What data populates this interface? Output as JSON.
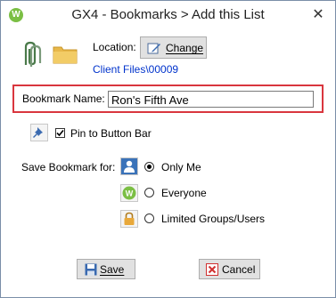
{
  "window": {
    "title": "GX4 - Bookmarks > Add this List",
    "close_glyph": "✕"
  },
  "location": {
    "label": "Location:",
    "change_label": "Change",
    "path": "Client Files\\00009"
  },
  "bookmark_name": {
    "label": "Bookmark Name:",
    "value": "Ron's Fifth Ave"
  },
  "pin": {
    "label": "Pin to Button Bar",
    "checked": true
  },
  "save_for": {
    "label": "Save Bookmark for:",
    "options": [
      {
        "label": "Only Me",
        "selected": true,
        "icon": "user-icon"
      },
      {
        "label": "Everyone",
        "selected": false,
        "icon": "globe-logo-icon"
      },
      {
        "label": "Limited Groups/Users",
        "selected": false,
        "icon": "lock-icon"
      }
    ]
  },
  "buttons": {
    "save_label": "Save",
    "cancel_label": "Cancel"
  },
  "colors": {
    "highlight_border": "#d9363e",
    "link_blue": "#0033cc",
    "brand_green": "#7bbf44"
  }
}
